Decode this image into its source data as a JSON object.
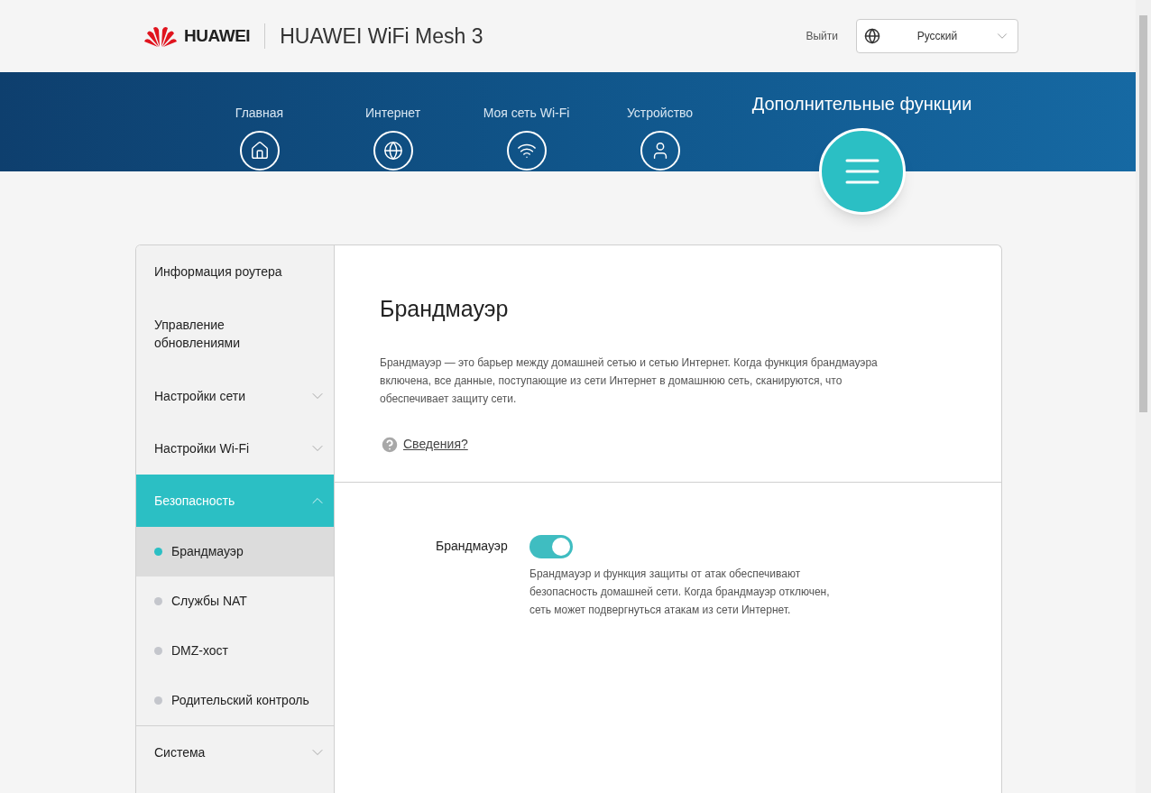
{
  "header": {
    "brand": "HUAWEI",
    "product": "HUAWEI WiFi Mesh 3",
    "logout": "Выйти",
    "language": "Русский"
  },
  "nav": [
    {
      "label": "Главная",
      "selected": false
    },
    {
      "label": "Интернет",
      "selected": false
    },
    {
      "label": "Моя сеть Wi-Fi",
      "selected": false
    },
    {
      "label": "Устройство",
      "selected": false
    },
    {
      "label": "Дополнительные функции",
      "selected": true
    }
  ],
  "sidebar": [
    {
      "label": "Информация роутера",
      "selected": false
    },
    {
      "label": "Управление обновлениями",
      "selected": false
    },
    {
      "label": "Настройки сети",
      "expandable": true,
      "expanded": false,
      "selected": false
    },
    {
      "label": "Настройки Wi-Fi",
      "expandable": true,
      "expanded": false,
      "selected": false
    },
    {
      "label": "Безопасность",
      "expandable": true,
      "expanded": true,
      "selected": true,
      "children": [
        {
          "label": "Брандмауэр",
          "selected": true
        },
        {
          "label": "Службы NAT",
          "selected": false
        },
        {
          "label": "DMZ-хост",
          "selected": false
        },
        {
          "label": "Родительский контроль",
          "selected": false
        }
      ]
    },
    {
      "label": "Система",
      "expandable": true,
      "expanded": false,
      "selected": false
    }
  ],
  "content": {
    "title": "Брандмауэр",
    "description": "Брандмауэр — это барьер между домашней сетью и сетью Интернет. Когда функция брандмауэра включена, все данные, поступающие из сети Интернет в домашнюю сеть, сканируются, что обеспечивает защиту сети.",
    "help_link": "Сведения?",
    "setting": {
      "label": "Брандмауэр",
      "on": true,
      "hint": "Брандмауэр и функция защиты от атак обеспечивают безопасность домашней сети. Когда брандмауэр отключен, сеть может подвергнуться атакам из сети Интернет."
    }
  }
}
